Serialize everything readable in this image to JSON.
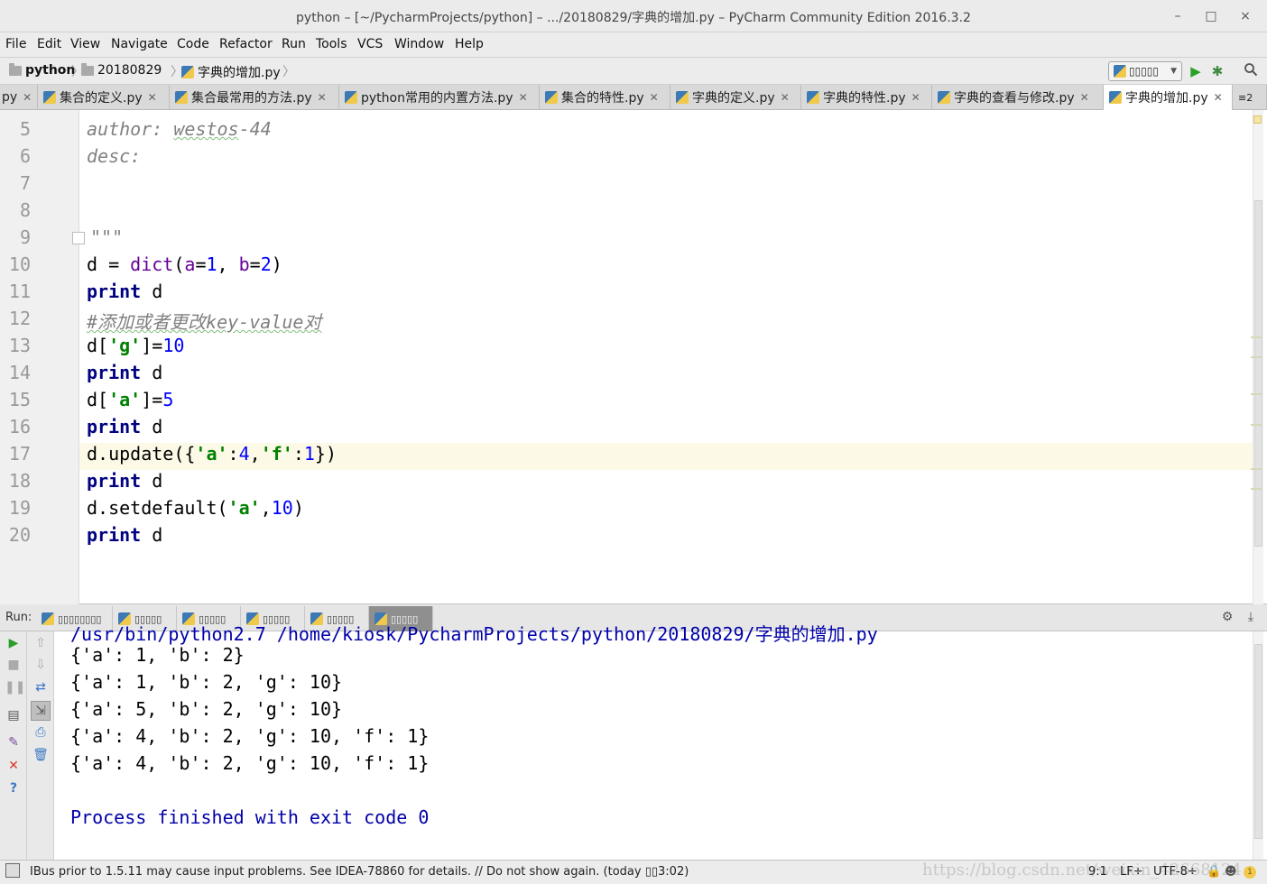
{
  "window": {
    "title": "python – [~/PycharmProjects/python] – .../20180829/字典的增加.py – PyCharm Community Edition 2016.3.2",
    "controls": [
      "–",
      "□",
      "×"
    ]
  },
  "menu": [
    "File",
    "Edit",
    "View",
    "Navigate",
    "Code",
    "Refactor",
    "Run",
    "Tools",
    "VCS",
    "Window",
    "Help"
  ],
  "breadcrumb": [
    "python",
    "20180829",
    "字典的增加.py"
  ],
  "run_config": "▯▯▯▯▯",
  "tabs": [
    {
      "label": "py",
      "active": false
    },
    {
      "label": "集合的定义.py",
      "active": false
    },
    {
      "label": "集合最常用的方法.py",
      "active": false
    },
    {
      "label": "python常用的内置方法.py",
      "active": false
    },
    {
      "label": "集合的特性.py",
      "active": false
    },
    {
      "label": "字典的定义.py",
      "active": false
    },
    {
      "label": "字典的特性.py",
      "active": false
    },
    {
      "label": "字典的查看与修改.py",
      "active": false
    },
    {
      "label": "字典的增加.py",
      "active": true
    }
  ],
  "tabs_overflow": "≡2",
  "editor": {
    "line_numbers": [
      "5",
      "6",
      "7",
      "8",
      "9",
      "10",
      "11",
      "12",
      "13",
      "14",
      "15",
      "16",
      "17",
      "18",
      "19",
      "20"
    ],
    "current_line": "17",
    "code": {
      "l5a": "author: ",
      "l5b": "westos",
      "l5c": "-44",
      "l6": "desc:",
      "l9": "\"\"\"",
      "l10": {
        "d": "d = ",
        "dict": "dict",
        "p1": "(",
        "a": "a",
        "eq1": "=",
        "one": "1",
        "comma": ", ",
        "b": "b",
        "eq2": "=",
        "two": "2",
        "p2": ")"
      },
      "print": "print",
      "d": " d",
      "l12": "#添加或者更改key-value对",
      "l13": {
        "a": "d[",
        "s": "'g'",
        "b": "]=",
        "n": "10"
      },
      "l15": {
        "a": "d[",
        "s": "'a'",
        "b": "]=",
        "n": "5"
      },
      "l17": {
        "a": "d.update({",
        "s1": "'a'",
        "c1": ":",
        "n1": "4",
        "c2": ",",
        "s2": "'f'",
        "c3": ":",
        "n2": "1",
        "e": "})"
      },
      "l19": {
        "a": "d.setdefault(",
        "s": "'a'",
        "c": ",",
        "n": "10",
        "e": ")"
      }
    }
  },
  "run_panel": {
    "label": "Run:",
    "tabs": [
      "▯▯▯▯▯▯▯▯",
      "▯▯▯▯▯",
      "▯▯▯▯▯",
      "▯▯▯▯▯",
      "▯▯▯▯▯",
      "▯▯▯▯▯"
    ],
    "active_tab": 5,
    "output": [
      "/usr/bin/python2.7 /home/kiosk/PycharmProjects/python/20180829/字典的增加.py",
      "{'a': 1, 'b': 2}",
      "{'a': 1, 'b': 2, 'g': 10}",
      "{'a': 5, 'b': 2, 'g': 10}",
      "{'a': 4, 'b': 2, 'g': 10, 'f': 1}",
      "{'a': 4, 'b': 2, 'g': 10, 'f': 1}",
      "",
      "Process finished with exit code 0"
    ]
  },
  "status": {
    "message": "IBus prior to 1.5.11 may cause input problems. See IDEA-78860 for details. // Do not show again. (today ▯▯3:02)",
    "position": "9:1",
    "line_sep": "LF÷",
    "encoding": "UTF-8÷",
    "watermark": "https://blog.csdn.net/weixin_42668124"
  },
  "colors": {
    "keyword": "#000080",
    "string": "#008000",
    "number": "#0000ff",
    "comment": "#808080",
    "console_text": "#0000aa",
    "current_line": "#fcfae6"
  }
}
